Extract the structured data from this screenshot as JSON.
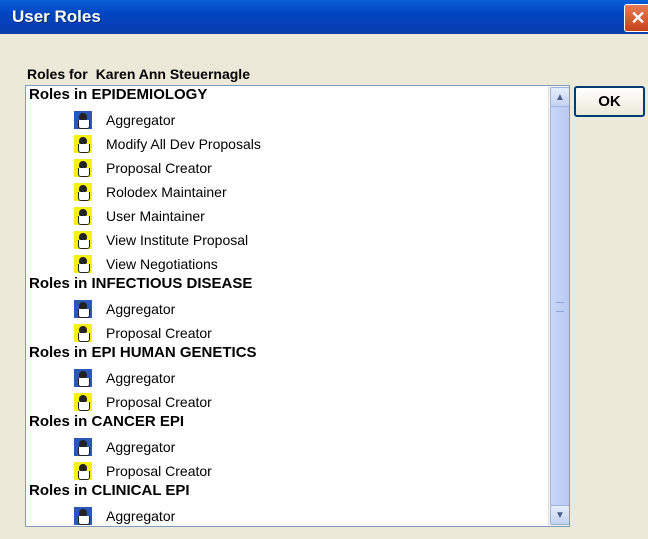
{
  "window": {
    "title": "User Roles"
  },
  "header": {
    "roles_for_label": "Roles for",
    "user_name": "Karen Ann Steuernagle"
  },
  "buttons": {
    "ok_label": "OK",
    "close_glyph": "✕"
  },
  "groups": [
    {
      "label": "Roles in EPIDEMIOLOGY",
      "items": [
        "Aggregator",
        "Modify All Dev Proposals",
        "Proposal Creator",
        "Rolodex Maintainer",
        "User Maintainer",
        "View Institute Proposal",
        "View Negotiations"
      ]
    },
    {
      "label": "Roles in INFECTIOUS DISEASE",
      "items": [
        "Aggregator",
        "Proposal Creator"
      ]
    },
    {
      "label": "Roles in EPI HUMAN GENETICS",
      "items": [
        "Aggregator",
        "Proposal Creator"
      ]
    },
    {
      "label": "Roles in CANCER EPI",
      "items": [
        "Aggregator",
        "Proposal Creator"
      ]
    },
    {
      "label": "Roles in CLINICAL EPI",
      "items": [
        "Aggregator"
      ]
    }
  ],
  "icons": {
    "aggregator": "user-icon-blue",
    "other": "user-icon-yellow"
  },
  "colors": {
    "title_bar": "#0a5fd8",
    "window_bg": "#ece9d8",
    "icon_blue": "#2b57b8",
    "icon_yellow": "#f7f017"
  }
}
